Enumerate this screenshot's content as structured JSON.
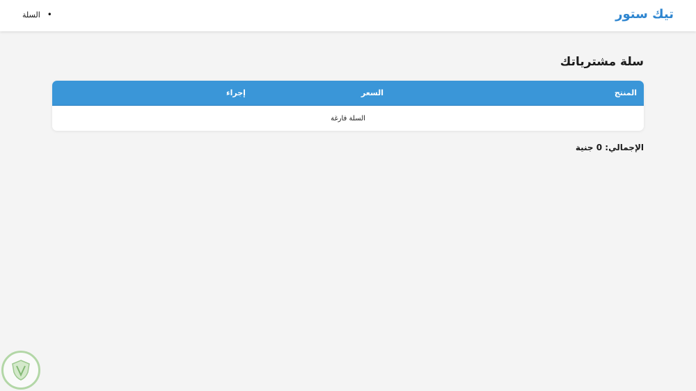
{
  "navbar": {
    "brand": "تيك ستور",
    "links": [
      {
        "label": "السلة"
      }
    ]
  },
  "cart": {
    "title": "سلة مشترياتك",
    "columns": {
      "product": "المنتج",
      "price": "السعر",
      "action": "إجراء"
    },
    "empty_message": "السلة فارغة",
    "total": "الإجمالي: 0 جنية"
  },
  "colors": {
    "brand": "#2f86d0",
    "table_header": "#3a96d8",
    "background": "#f4f4f4"
  },
  "icons": {
    "watermark": "shield-logo-icon"
  }
}
